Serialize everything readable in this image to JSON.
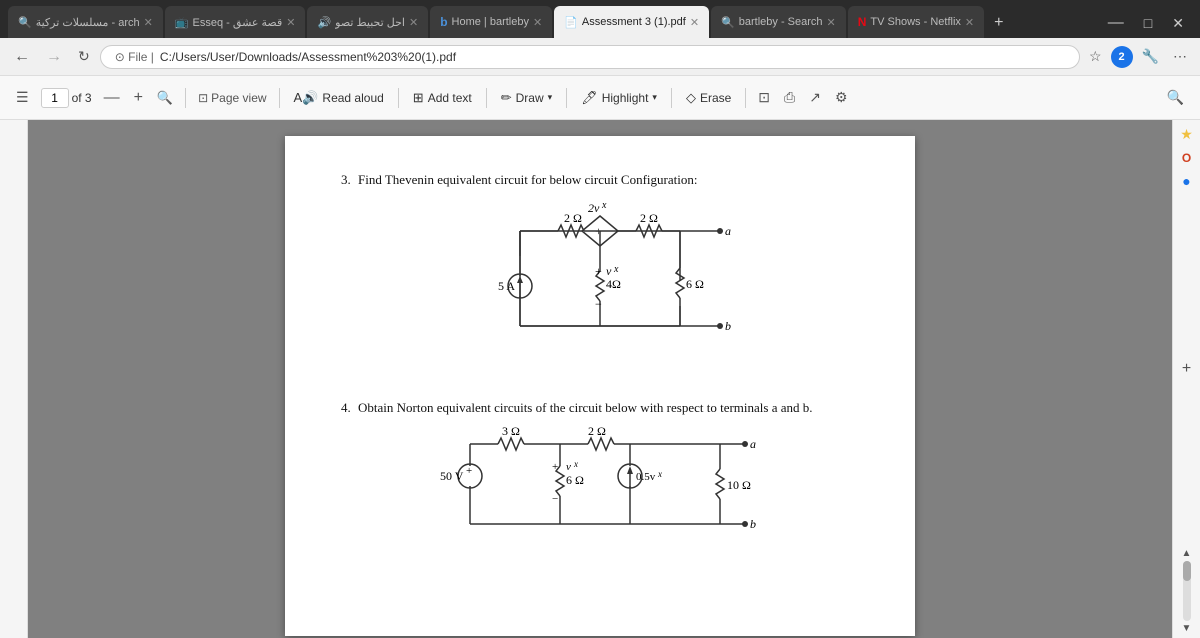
{
  "browser": {
    "tabs": [
      {
        "id": "tab-1",
        "label": "مسلسلات تركية - arch",
        "active": false,
        "favicon": "🔍"
      },
      {
        "id": "tab-2",
        "label": "Esseq - قصة عشق",
        "active": false,
        "favicon": "📺"
      },
      {
        "id": "tab-3",
        "label": "احل تحبيط تصو",
        "active": false,
        "favicon": "▶"
      },
      {
        "id": "tab-4",
        "label": "Home | bartleby",
        "active": false,
        "favicon": "b"
      },
      {
        "id": "tab-5",
        "label": "Assessment 3 (1).pdf",
        "active": true,
        "favicon": "📄"
      },
      {
        "id": "tab-6",
        "label": "bartleby - Search",
        "active": false,
        "favicon": "🔍"
      },
      {
        "id": "tab-7",
        "label": "TV Shows - Netflix",
        "active": false,
        "favicon": "N"
      }
    ],
    "address": "C:/Users/User/Downloads/Assessment%203%20(1).pdf",
    "address_prefix": "File |"
  },
  "pdf_toolbar": {
    "page_current": "1",
    "page_total": "of 3",
    "page_view_label": "Page view",
    "read_aloud_label": "Read aloud",
    "add_text_label": "Add text",
    "draw_label": "Draw",
    "highlight_label": "Highlight",
    "erase_label": "Erase"
  },
  "pdf_content": {
    "question3": {
      "number": "3.",
      "text": "Find Thevenin equivalent circuit for below circuit Configuration:"
    },
    "question4": {
      "number": "4.",
      "text": "Obtain Norton equivalent circuits of the circuit below with respect to terminals a and b."
    }
  },
  "sidebar_right_icons": [
    {
      "name": "star-icon",
      "glyph": "★"
    },
    {
      "name": "office-icon",
      "glyph": "O"
    },
    {
      "name": "outlook-icon",
      "glyph": "●"
    },
    {
      "name": "add-icon",
      "glyph": "+"
    }
  ]
}
